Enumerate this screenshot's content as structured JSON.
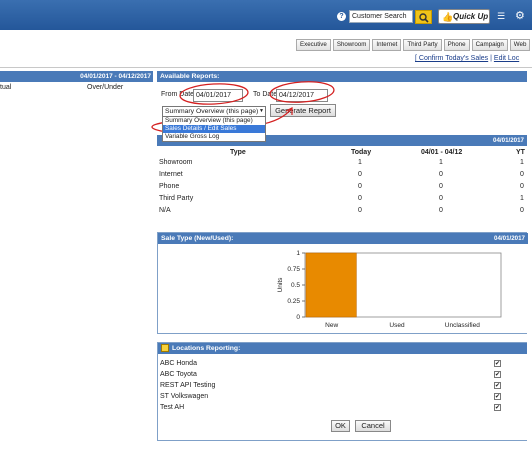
{
  "topbar": {
    "help_icon": "question-icon",
    "search_value": "Customer Search",
    "quickup_label": "Quick Up",
    "icons": [
      "search-icon",
      "thumbs-up-icon",
      "cart-icon",
      "gear-icon"
    ]
  },
  "nav_tabs": [
    "Executive",
    "Showroom",
    "Internet",
    "Third Party",
    "Phone",
    "Campaign",
    "Web"
  ],
  "links": {
    "confirm": "[ Confirm Today's Sales",
    "sep": " | ",
    "edit": "Edit Loc"
  },
  "left_panel": {
    "range": "04/01/2017 - 04/12/2017",
    "col1": "tual",
    "col2": "Over/Under"
  },
  "reports": {
    "title": "Available Reports:",
    "from_label": "From Date:",
    "from_value": "04/01/2017",
    "to_label": "To Date:",
    "to_value": "04/12/2017",
    "selected_report": "Summary Overview (this page)",
    "options": [
      "Summary Overview (this page)",
      "Sales Details / Edit Sales",
      "Variable Gross Log"
    ],
    "generate_label": "Generate Report"
  },
  "summary": {
    "range": "04/01/2017",
    "headers": [
      "Type",
      "Today",
      "04/01 - 04/12",
      "YT"
    ],
    "rows": [
      [
        "Showroom",
        "1",
        "1",
        "1"
      ],
      [
        "Internet",
        "0",
        "0",
        "0"
      ],
      [
        "Phone",
        "0",
        "0",
        "0"
      ],
      [
        "Third Party",
        "0",
        "0",
        "1"
      ],
      [
        "N/A",
        "0",
        "0",
        "0"
      ]
    ]
  },
  "sale_type": {
    "title": "Sale Type (New/Used):",
    "range": "04/01/2017"
  },
  "chart_data": {
    "type": "bar",
    "categories": [
      "New",
      "Used",
      "Unclassified"
    ],
    "values": [
      1,
      0,
      0
    ],
    "ylabel": "Units",
    "ylim": [
      0,
      1
    ],
    "yticks": [
      "0",
      "0.25",
      "0.5",
      "0.75",
      "1"
    ],
    "bar_color": "#e88a00",
    "grid": false
  },
  "locations": {
    "title": "Locations Reporting:",
    "items": [
      {
        "name": "ABC Honda",
        "checked": true
      },
      {
        "name": "ABC Toyota",
        "checked": true
      },
      {
        "name": "REST API Testing",
        "checked": true
      },
      {
        "name": "ST Volkswagen",
        "checked": true
      },
      {
        "name": "Test AH",
        "checked": true
      }
    ],
    "check_mark": "✔",
    "ok_label": "OK",
    "cancel_label": "Cancel"
  },
  "colors": {
    "header_blue": "#4a7ab8",
    "topbar_blue": "#24579a",
    "accent_yellow": "#f0c419",
    "annotation_red": "#d42020"
  }
}
